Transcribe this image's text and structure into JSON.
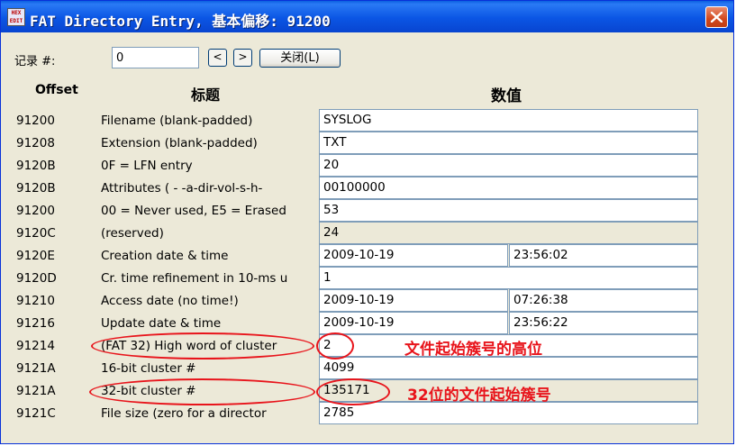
{
  "window": {
    "title": "FAT Directory Entry, 基本偏移: 91200",
    "icon_text": [
      "HEX",
      "EDIT"
    ]
  },
  "record": {
    "label": "记录 #:",
    "value": "0",
    "prev": "<",
    "next": ">",
    "close": "关闭(L)"
  },
  "headers": {
    "offset": "Offset",
    "title": "标题",
    "value": "数值"
  },
  "rows": [
    {
      "offset": "91200",
      "label": "Filename (blank-padded)",
      "value": "SYSLOG"
    },
    {
      "offset": "91208",
      "label": "Extension (blank-padded)",
      "value": "TXT"
    },
    {
      "offset": "9120B",
      "label": "0F = LFN entry",
      "value": "20"
    },
    {
      "offset": "9120B",
      "label": "Attributes ( - -a-dir-vol-s-h-",
      "value": "00100000"
    },
    {
      "offset": "91200",
      "label": "00 = Never used, E5 = Erased",
      "value": "53"
    },
    {
      "offset": "9120C",
      "label": "(reserved)",
      "value": "24"
    },
    {
      "offset": "9120E",
      "label": "Creation date & time",
      "value": "2009-10-19",
      "value2": "23:56:02"
    },
    {
      "offset": "9120D",
      "label": "Cr. time refinement in 10-ms u",
      "value": "1"
    },
    {
      "offset": "91210",
      "label": "Access date (no time!)",
      "value": "2009-10-19",
      "value2": "07:26:38"
    },
    {
      "offset": "91216",
      "label": "Update date & time",
      "value": "2009-10-19",
      "value2": "23:56:22"
    },
    {
      "offset": "91214",
      "label": "(FAT 32) High word of cluster",
      "value": "2"
    },
    {
      "offset": "9121A",
      "label": "16-bit cluster #",
      "value": "4099"
    },
    {
      "offset": "9121A",
      "label": "32-bit cluster #",
      "value": "135171"
    },
    {
      "offset": "9121C",
      "label": "File size (zero for a director",
      "value": "2785"
    }
  ],
  "annotations": {
    "high_word_note": "文件起始簇号的高位",
    "cluster_note": "32位的文件起始簇号"
  },
  "colors": {
    "annotation": "#e8141b",
    "titlebar": "#0b55e4"
  }
}
